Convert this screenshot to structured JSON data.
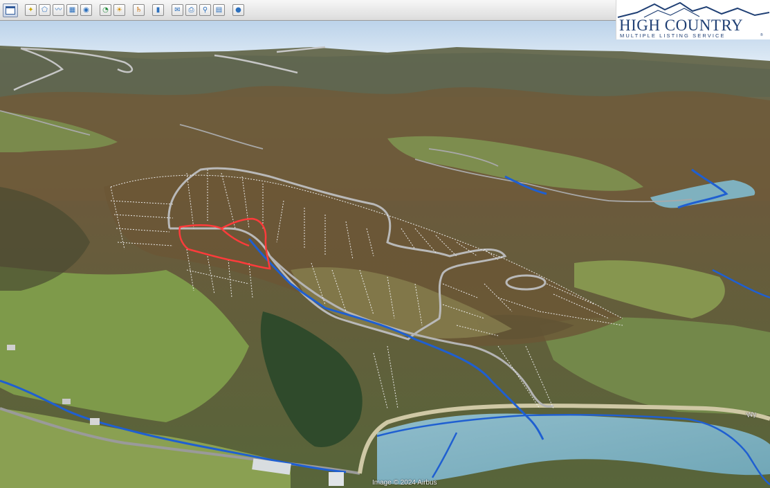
{
  "toolbar": {
    "buttons": [
      {
        "name": "placemark-button",
        "glyph": "✦",
        "color": "#c9a400"
      },
      {
        "name": "polygon-button",
        "glyph": "⬠",
        "color": "#2b6fbd"
      },
      {
        "name": "path-button",
        "glyph": "〰",
        "color": "#2b6fbd"
      },
      {
        "name": "overlay-button",
        "glyph": "▦",
        "color": "#2b6fbd"
      },
      {
        "name": "record-tour-button",
        "glyph": "◉",
        "color": "#2b6fbd"
      },
      {
        "name": "historical-imagery-button",
        "glyph": "◔",
        "color": "#1f8a3a"
      },
      {
        "name": "sunlight-button",
        "glyph": "☀",
        "color": "#d08a00"
      },
      {
        "name": "planets-button",
        "glyph": "♄",
        "color": "#c86a00"
      },
      {
        "name": "ruler-button",
        "glyph": "▮",
        "color": "#2b6fbd"
      },
      {
        "name": "email-button",
        "glyph": "✉",
        "color": "#2b6fbd"
      },
      {
        "name": "print-button",
        "glyph": "⎙",
        "color": "#2b6fbd"
      },
      {
        "name": "save-image-button",
        "glyph": "⚲",
        "color": "#2b6fbd"
      },
      {
        "name": "view-in-maps-button",
        "glyph": "▤",
        "color": "#2b6fbd"
      },
      {
        "name": "earth-gallery-button",
        "glyph": "●",
        "color": "#2b6fbd"
      }
    ]
  },
  "logo": {
    "title": "HIGH COUNTRY",
    "subtitle": "MULTIPLE LISTING SERVICE",
    "tm": "®",
    "color": "#1f3f74"
  },
  "map": {
    "attribution": "Image © 2024 Airbus",
    "road_label": "Wy"
  },
  "colors": {
    "boundary": "#ff3b3b",
    "lot_lines": "#f2f2f2",
    "road": "#b9b9b9",
    "water": "#1f5fd1",
    "lake": "#7fb1bf"
  }
}
